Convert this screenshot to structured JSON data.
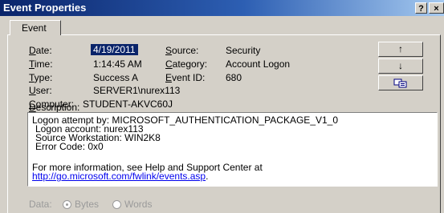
{
  "window": {
    "title": "Event Properties",
    "help_glyph": "?",
    "close_glyph": "×"
  },
  "tabs": [
    {
      "label": "Event"
    }
  ],
  "fields": {
    "date": {
      "label": "Date:",
      "value": "4/19/2011"
    },
    "time": {
      "label": "Time:",
      "value": "1:14:45 AM"
    },
    "type": {
      "label": "Type:",
      "value": "Success A"
    },
    "user": {
      "label": "User:",
      "value": "SERVER1\\nurex113"
    },
    "computer": {
      "label": "Computer:",
      "value": "STUDENT-AKVC60J"
    },
    "source": {
      "label": "Source:",
      "value": "Security"
    },
    "category": {
      "label": "Category:",
      "value": "Account Logon"
    },
    "event_id": {
      "label": "Event ID:",
      "value": "680"
    }
  },
  "side_buttons": {
    "up": "↑",
    "down": "↓",
    "copy": "copy-icon"
  },
  "description": {
    "label": "Description:",
    "lines": [
      "Logon attempt by:   MICROSOFT_AUTHENTICATION_PACKAGE_V1_0",
      "Logon account:     nurex113",
      "Source Workstation:             WIN2K8",
      "Error Code:          0x0"
    ],
    "more_info": "For more information, see Help and Support Center at",
    "link": "http://go.microsoft.com/fwlink/events.asp",
    "link_suffix": "."
  },
  "data_section": {
    "label": "Data:",
    "bytes": "Bytes",
    "words": "Words",
    "selected": "Bytes"
  }
}
